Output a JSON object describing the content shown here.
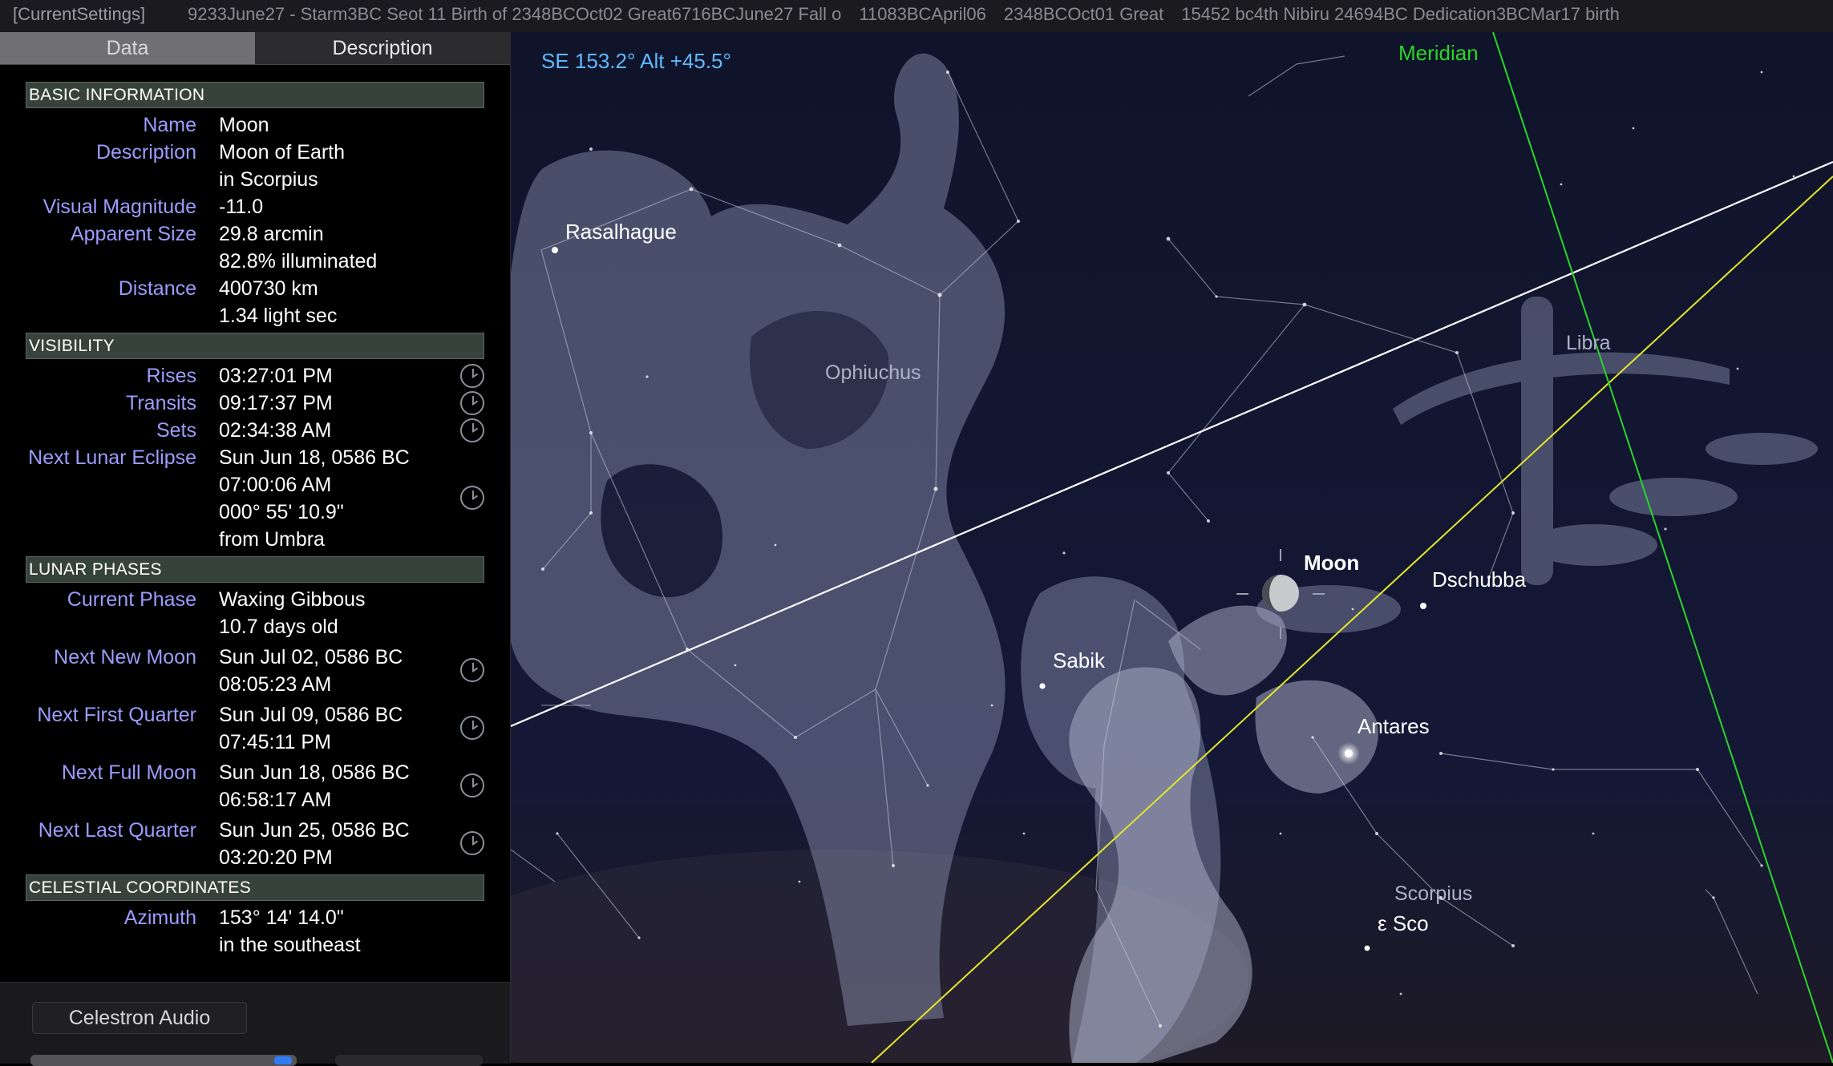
{
  "topbar": {
    "tag": "[CurrentSettings]",
    "items": [
      "9233June27 - Starm3BC Seot 11 Birth of 2348BCOct02 Great6716BCJune27 Fall o",
      "11083BCApril06",
      "2348BCOct01 Great",
      "15452 bc4th Nibiru 24694BC Dedication3BCMar17 birth"
    ]
  },
  "tabs": {
    "data": "Data",
    "description": "Description"
  },
  "sections": {
    "basic": "BASIC INFORMATION",
    "visibility": "VISIBILITY",
    "phases": "LUNAR PHASES",
    "coords": "CELESTIAL COORDINATES"
  },
  "basic": [
    {
      "label": "Name",
      "value": "Moon"
    },
    {
      "label": "Description",
      "value": "Moon of Earth\nin Scorpius"
    },
    {
      "label": "Visual Magnitude",
      "value": "-11.0"
    },
    {
      "label": "Apparent Size",
      "value": "29.8 arcmin\n82.8% illuminated"
    },
    {
      "label": "Distance",
      "value": "400730 km\n1.34 light sec"
    }
  ],
  "visibility": [
    {
      "label": "Rises",
      "value": "03:27:01 PM"
    },
    {
      "label": "Transits",
      "value": "09:17:37 PM"
    },
    {
      "label": "Sets",
      "value": "02:34:38 AM"
    },
    {
      "label": "Next Lunar Eclipse",
      "value": "Sun Jun 18, 0586 BC\n07:00:06 AM\n000° 55' 10.9\"\nfrom Umbra"
    }
  ],
  "phases": [
    {
      "label": "Current Phase",
      "value": "Waxing Gibbous\n10.7 days old"
    },
    {
      "label": "Next New Moon",
      "value": "Sun Jul 02, 0586 BC\n08:05:23 AM"
    },
    {
      "label": "Next First Quarter",
      "value": "Sun Jul 09, 0586 BC\n07:45:11 PM"
    },
    {
      "label": "Next Full Moon",
      "value": "Sun Jun 18, 0586 BC\n06:58:17 AM"
    },
    {
      "label": "Next Last Quarter",
      "value": "Sun Jun 25, 0586 BC\n03:20:20 PM"
    }
  ],
  "coords": [
    {
      "label": "Azimuth",
      "value": "153° 14' 14.0\"\nin the southeast"
    }
  ],
  "bottom": {
    "celestron": "Celestron Audio"
  },
  "sky": {
    "position_readout": "SE 153.2° Alt +45.5°",
    "meridian": "Meridian",
    "stars": {
      "rasalhague": "Rasalhague",
      "sabik": "Sabik",
      "moon": "Moon",
      "dschubba": "Dschubba",
      "antares": "Antares",
      "eps_sco": "ε Sco"
    },
    "constellations": {
      "ophiuchus": "Ophiuchus",
      "libra": "Libra",
      "scorpius": "Scorpius"
    },
    "colors": {
      "background": "#10142a",
      "meridian": "#2bd42b",
      "ecliptic": "#e6e62a",
      "equator": "#ffffff",
      "readout": "#5fb8ff"
    }
  }
}
